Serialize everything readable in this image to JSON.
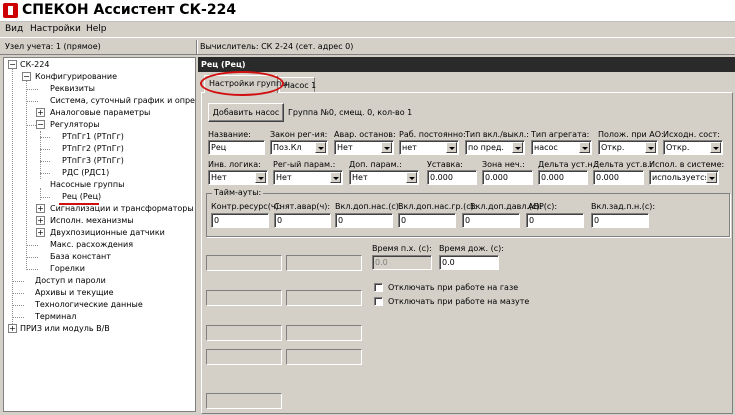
{
  "window": {
    "title": "СПЕКОН Ассистент СК-224"
  },
  "menu": [
    "Вид",
    "Настройки",
    "Help"
  ],
  "status": {
    "node": "Узел учета: 1 (прямое)",
    "calc": "Вычислитель: СК 2-24 (сет. адрес 0)"
  },
  "tree": {
    "root": "СК-224",
    "items": [
      "Конфигурирование",
      "Реквизиты",
      "Система, суточный график и опрессо",
      "Аналоговые параметры",
      "Регуляторы",
      "РТпГг1 (РТпГг)",
      "РТпГг2 (РТпГг)",
      "РТпГг3 (РТпГг)",
      "РДС (РДС1)",
      "Насосные группы",
      "Рец (Рец)",
      "Сигнализации и трансформаторы",
      "Исполн. механизмы",
      "Двухпозиционные датчики",
      "Макс. расхождения",
      "База констант",
      "Горелки",
      "Доступ и пароли",
      "Архивы и текущие",
      "Технологические данные",
      "Терминал",
      "ПРИЗ или модуль В/В"
    ]
  },
  "panel": {
    "header": "Рец (Рец)",
    "tabs": [
      "Настройки группы",
      "Насос 1"
    ],
    "add_pump_button": "Добавить насос",
    "group_info": "Группа №0, смещ. 0, кол-во 1",
    "row1": {
      "labels": [
        "Название:",
        "Закон рег-ия:",
        "Авар. останов:",
        "Раб. постоянно:",
        "Тип вкл./выкл.:",
        "Тип агрегата:",
        "Полож. при АО:",
        "Исходн. сост:"
      ],
      "values": [
        "Рец",
        "Поз.Кл",
        "Нет",
        "нет",
        "по пред.",
        "насос",
        "Откр.",
        "Откр."
      ]
    },
    "row2": {
      "labels": [
        "Инв. логика:",
        "Рег-ый парам.:",
        "Доп. парам.:",
        "Уставка:",
        "Зона неч.:",
        "Дельта уст.н.:",
        "Дельта уст.в.:",
        "Испол. в системе:"
      ],
      "values": [
        "Нет",
        "Нет",
        "Нет",
        "0.000",
        "0.000",
        "0.000",
        "0.000",
        "используется"
      ]
    },
    "timeouts": {
      "title": "Тайм-ауты:",
      "labels": [
        "Контр.ресурс(ч):",
        "Снят.авар(ч):",
        "Вкл.доп.нас.(с):",
        "Вкл.доп.нас.гр.(с):",
        "Вкл.доп.давл.(с):",
        "АВР(с):",
        "Вкл.зад.п.н.(с):"
      ],
      "values": [
        "0",
        "0",
        "0",
        "0",
        "0",
        "0",
        "0"
      ]
    },
    "time_px_label": "Время п.х. (с):",
    "time_px_value": "0.0",
    "time_dozh_label": "Время дож. (с):",
    "time_dozh_value": "0.0",
    "cb_gas": "Отключать при работе на газе",
    "cb_mazut": "Отключать при работе на мазуте"
  }
}
